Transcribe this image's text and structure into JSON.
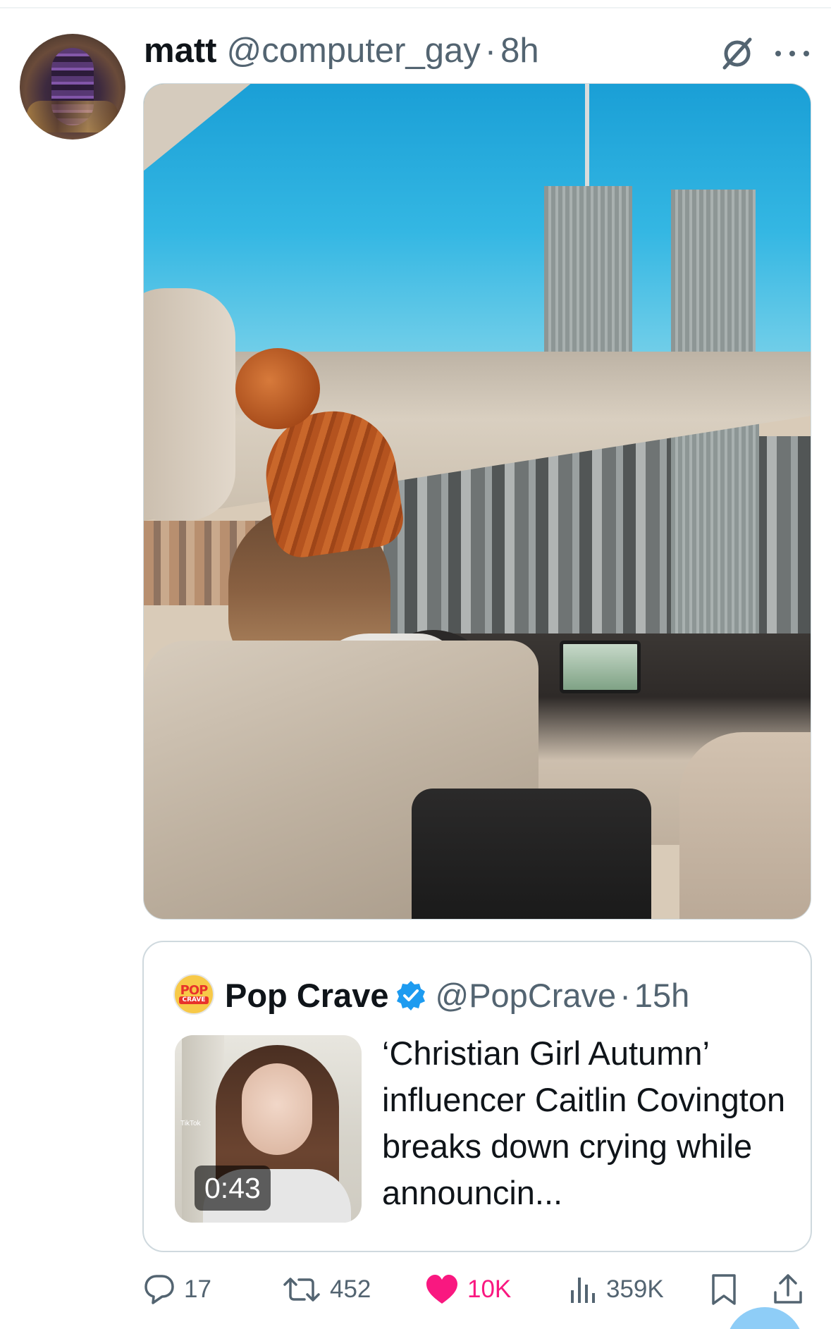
{
  "post": {
    "author_name": "matt",
    "author_handle": "@computer_gay",
    "separator": "·",
    "time": "8h",
    "avatar_icon": "vessel-photo-avatar",
    "media": {
      "type": "photo"
    }
  },
  "quoted": {
    "author_name": "Pop Crave",
    "avatar_text_top": "POP",
    "avatar_text_bottom": "CRAVE",
    "verified_icon": "verified-badge-icon",
    "author_handle": "@PopCrave",
    "separator": "·",
    "time": "15h",
    "video_duration": "0:43",
    "thumbnail_watermark": "TikTok",
    "text": "‘Christian Girl Autumn’ influencer Caitlin Covington breaks down crying while announcin..."
  },
  "actions": {
    "replies": "17",
    "reposts": "452",
    "likes": "10K",
    "views": "359K"
  },
  "colors": {
    "text_primary": "#0f1419",
    "text_secondary": "#536471",
    "like_pink": "#f91880",
    "verified_blue": "#1d9bf0",
    "border": "#cfd9de"
  }
}
